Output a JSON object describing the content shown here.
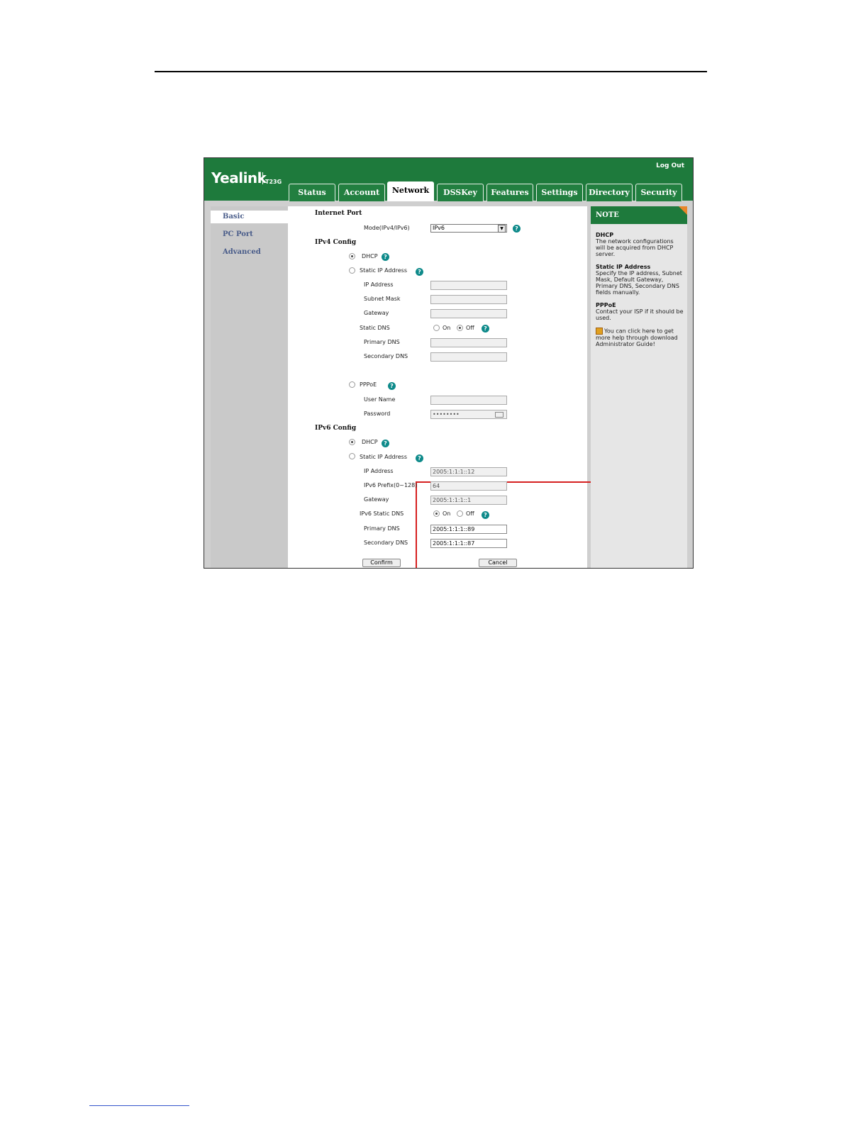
{
  "topbar": {
    "logo": "Yealink",
    "model": "T23G",
    "logout": "Log Out",
    "tabs": [
      "Status",
      "Account",
      "Network",
      "DSSKey",
      "Features",
      "Settings",
      "Directory",
      "Security"
    ],
    "active_tab": "Network"
  },
  "sidebar": {
    "items": [
      "Basic",
      "PC Port",
      "Advanced"
    ]
  },
  "internet_port": {
    "title": "Internet Port",
    "mode_label": "Mode(IPv4/IPv6)",
    "mode_value": "IPv6"
  },
  "ipv4": {
    "title": "IPv4 Config",
    "dhcp": "DHCP",
    "static_ip": "Static IP Address",
    "ip_address": "IP Address",
    "subnet_mask": "Subnet Mask",
    "gateway": "Gateway",
    "static_dns": "Static DNS",
    "on": "On",
    "off": "Off",
    "primary_dns": "Primary DNS",
    "secondary_dns": "Secondary DNS",
    "pppoe": "PPPoE",
    "user_name": "User Name",
    "password": "Password",
    "password_value": "••••••••"
  },
  "ipv6": {
    "title": "IPv6 Config",
    "dhcp": "DHCP",
    "static_ip": "Static IP Address",
    "ip_address": "IP Address",
    "ip_address_value": "2005:1:1:1::12",
    "prefix": "IPv6 Prefix(0~128)",
    "prefix_value": "64",
    "gateway": "Gateway",
    "gateway_value": "2005:1:1:1::1",
    "static_dns": "IPv6 Static DNS",
    "on": "On",
    "off": "Off",
    "primary_dns": "Primary DNS",
    "primary_dns_value": "2005:1:1:1::89",
    "secondary_dns": "Secondary DNS",
    "secondary_dns_value": "2005:1:1:1::87"
  },
  "buttons": {
    "confirm": "Confirm",
    "cancel": "Cancel"
  },
  "note": {
    "title": "NOTE",
    "dhcp_title": "DHCP",
    "dhcp_text": "The network configurations will be acquired from DHCP server.",
    "static_title": "Static IP Address",
    "static_text": "Specify the IP address, Subnet Mask, Default Gateway, Primary DNS, Secondary DNS fields manually.",
    "pppoe_title": "PPPoE",
    "pppoe_text": "Contact your ISP if it should be used.",
    "help_text": "You can click here to get more help through download Administrator Guide!"
  },
  "colors": {
    "brand_green": "#1e7a3c",
    "highlight_red": "#d62020",
    "help_teal": "#0e8a8a"
  }
}
